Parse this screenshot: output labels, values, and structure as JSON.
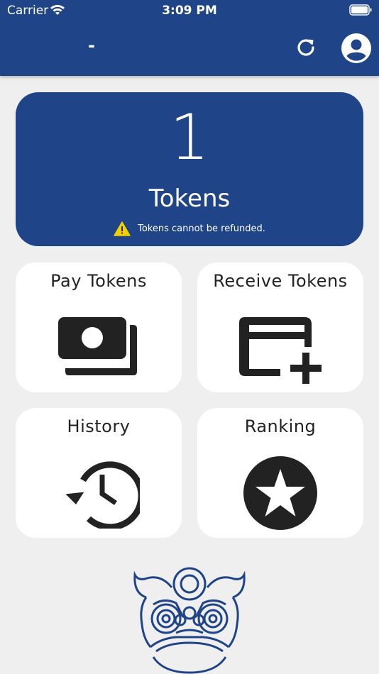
{
  "status_bar": {
    "carrier": "Carrier",
    "time": "3:09 PM"
  },
  "nav": {
    "title": "-"
  },
  "balance": {
    "value": "1",
    "unit": "Tokens",
    "notice": "Tokens cannot be refunded."
  },
  "tiles": [
    {
      "label": "Pay Tokens",
      "icon": "money-icon"
    },
    {
      "label": "Receive Tokens",
      "icon": "card-add-icon"
    },
    {
      "label": "History",
      "icon": "history-icon"
    },
    {
      "label": "Ranking",
      "icon": "star-circle-icon"
    }
  ],
  "colors": {
    "primary": "#1f4487",
    "background": "#efefef",
    "tile": "#ffffff",
    "icon": "#222222",
    "warning": "#f5d000"
  }
}
